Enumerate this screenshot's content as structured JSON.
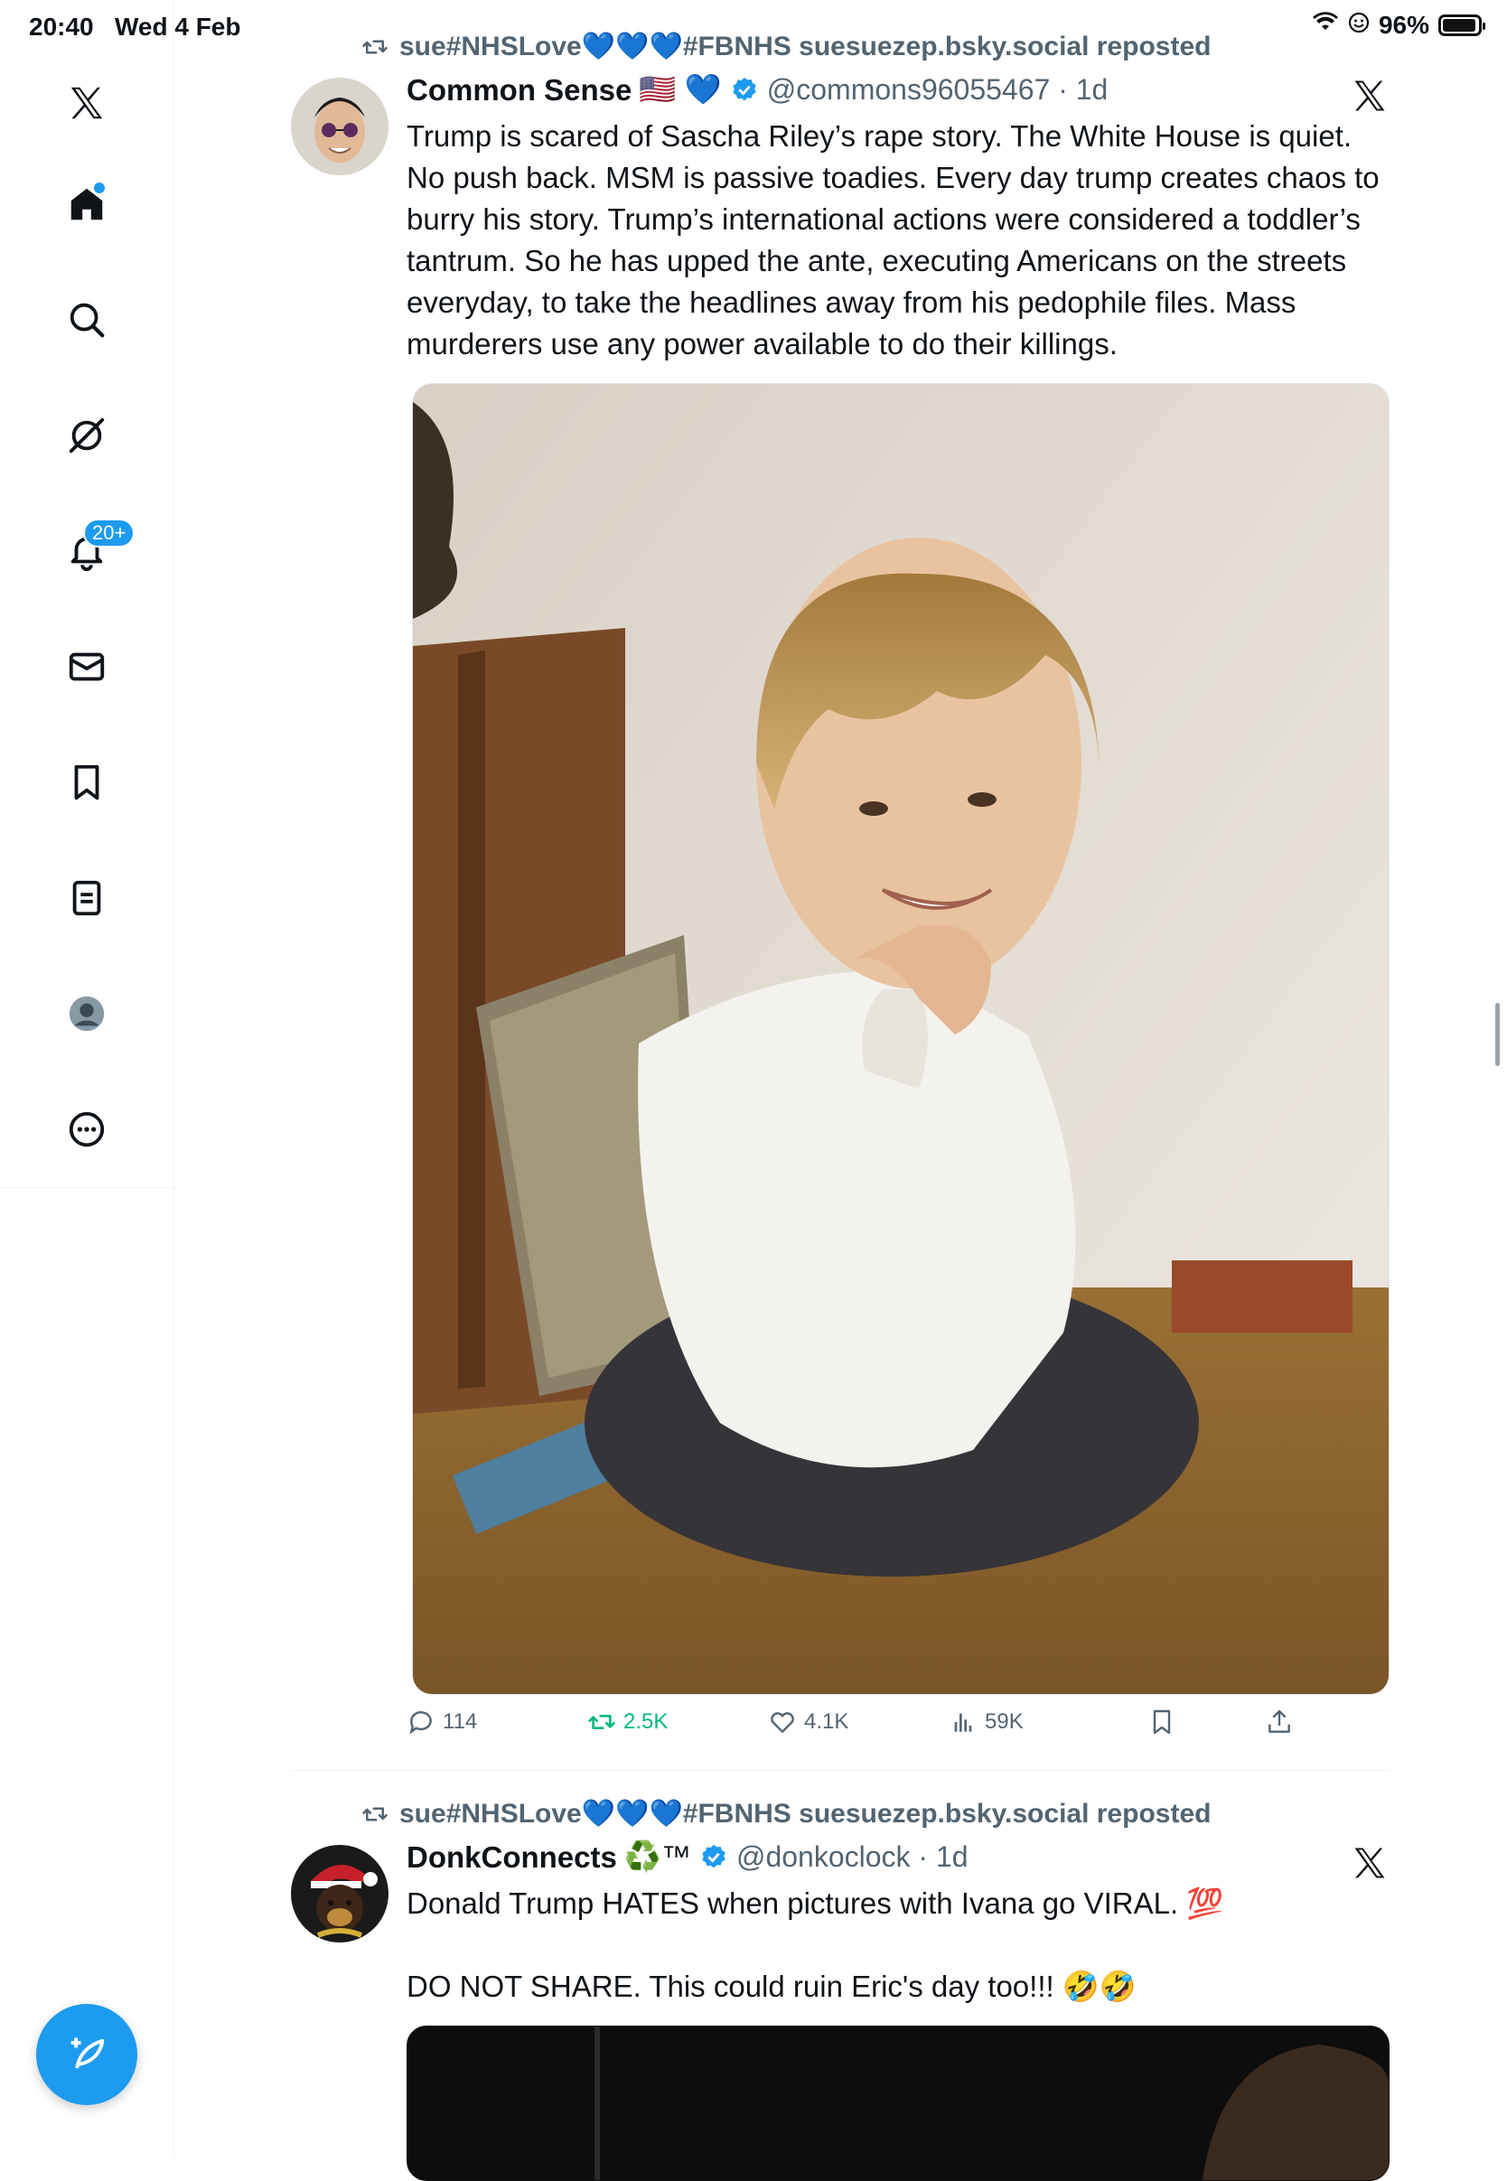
{
  "status_bar": {
    "time": "20:40",
    "date": "Wed 4 Feb",
    "battery": "96%"
  },
  "sidebar": {
    "notifications_badge": "20+",
    "items": [
      "x-logo",
      "home-icon",
      "search-icon",
      "grok-icon",
      "bell-icon",
      "mail-icon",
      "bookmark-icon",
      "lists-icon",
      "profile-icon",
      "more-icon"
    ]
  },
  "posts": [
    {
      "repost_by": "sue#NHSLove💙💙💙#FBNHS suesuezep.bsky.social reposted",
      "author_name": "Common Sense",
      "author_emoji": "🇺🇸 💙",
      "handle_time": "@commons96055467 · 1d",
      "text": "Trump is scared of Sascha Riley’s rape story. The White House is quiet. No push back. MSM is passive toadies. Every day trump creates chaos to burry his story. Trump’s international actions were considered a toddler’s tantrum. So he has upped the ante, executing Americans on the streets everyday, to take the headlines away from his pedophile files. Mass murderers use any power available to do their killings.",
      "replies": "114",
      "reposts": "2.5K",
      "likes": "4.1K",
      "views": "59K"
    },
    {
      "repost_by": "sue#NHSLove💙💙💙#FBNHS suesuezep.bsky.social reposted",
      "author_name": "DonkConnects",
      "author_emoji": "♻️™",
      "handle_time": "@donkoclock · 1d",
      "text": "Donald Trump HATES when pictures with Ivana go VIRAL. 💯\n\nDO NOT SHARE. This could ruin Eric's day too!!! 🤣🤣"
    }
  ],
  "colors": {
    "accent": "#1d9bf0",
    "secondary_text": "#536471",
    "repost_green": "#00ba7c"
  }
}
